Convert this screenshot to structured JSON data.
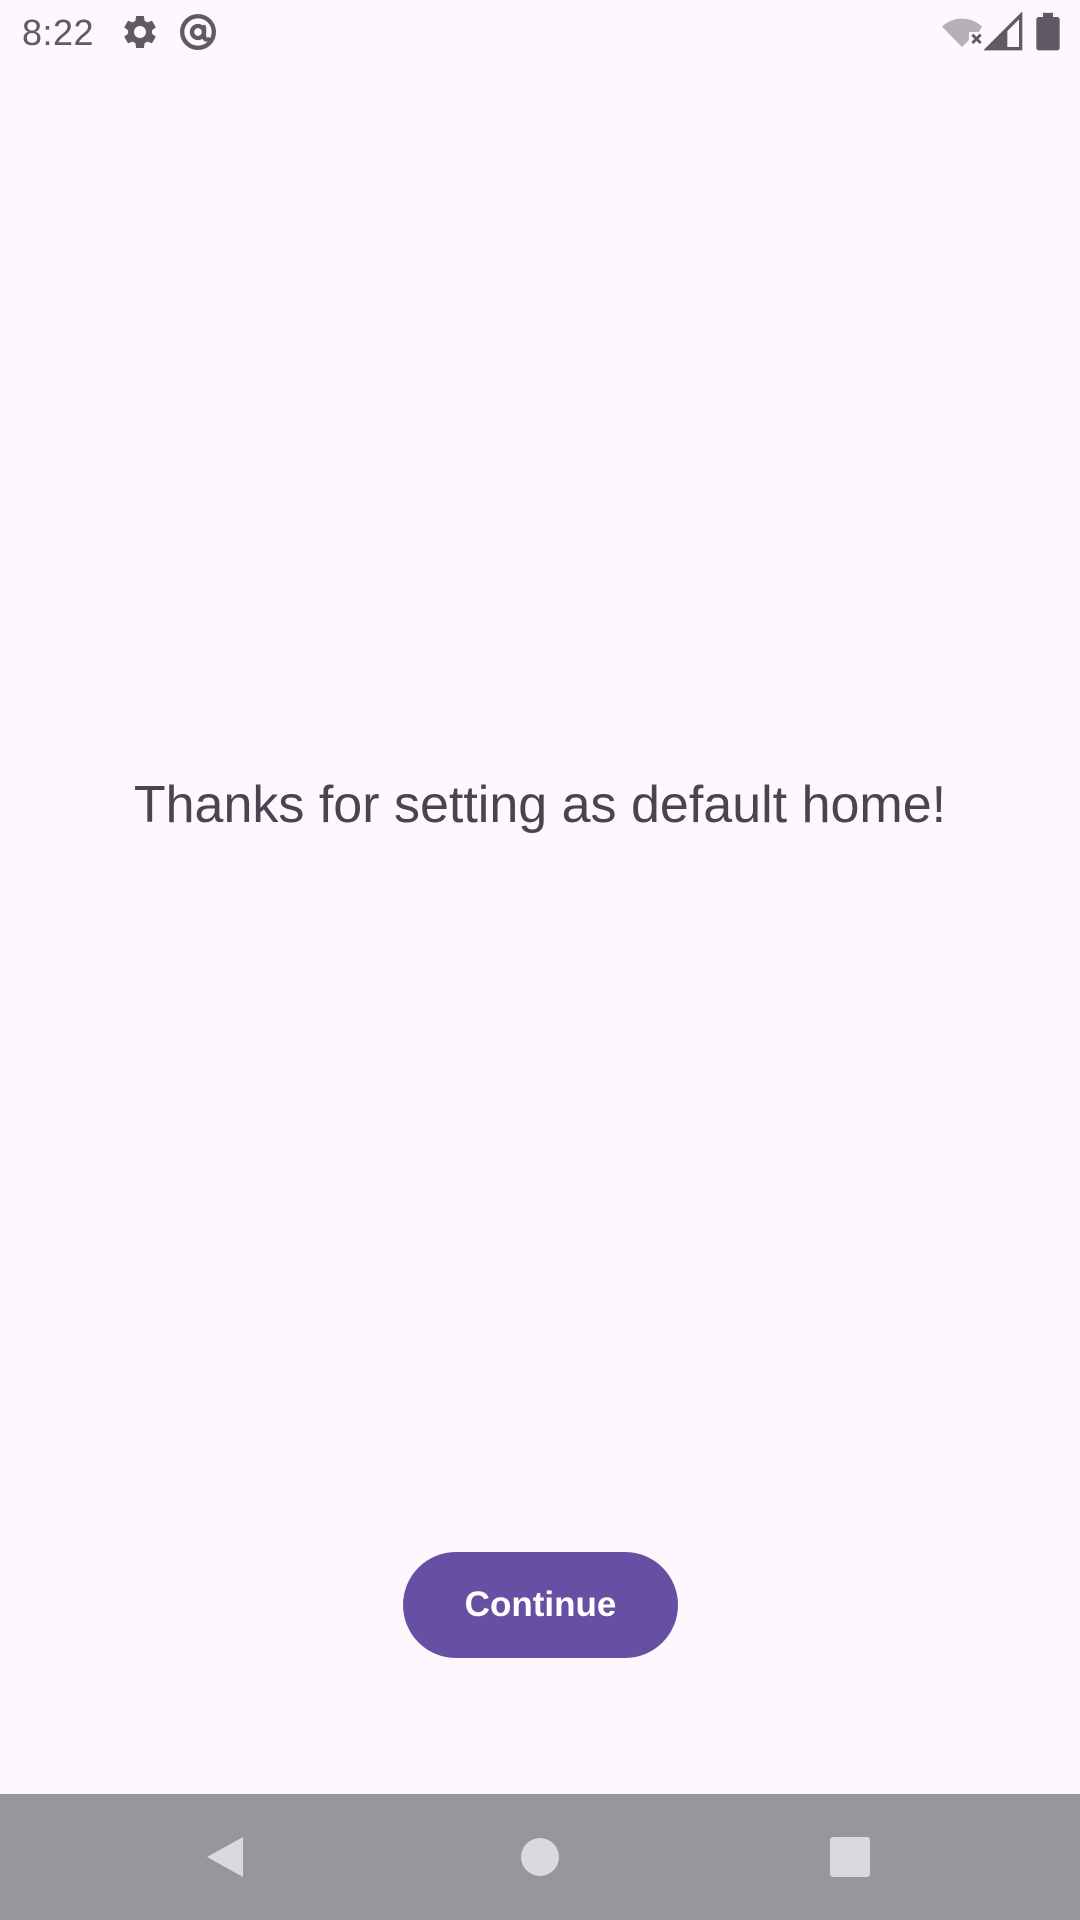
{
  "status_bar": {
    "time": "8:22",
    "icons": [
      "settings-gear-icon",
      "at-sign-icon",
      "wifi-off-icon",
      "cellular-signal-icon",
      "battery-icon"
    ]
  },
  "main": {
    "message": "Thanks for setting as default home!",
    "continue_label": "Continue"
  },
  "nav_bar": {
    "buttons": [
      "back-icon",
      "home-icon",
      "recents-icon"
    ]
  },
  "colors": {
    "background": "#FDF7FE",
    "primary": "#6750A4",
    "text": "#4a4450",
    "nav_bar": "#99969b"
  }
}
